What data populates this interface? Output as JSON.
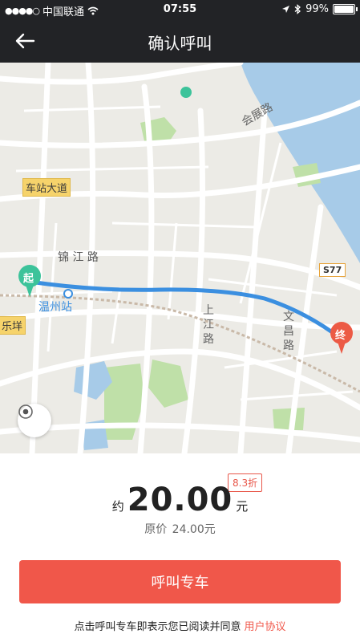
{
  "status": {
    "carrier": "中国联通",
    "time": "07:55",
    "battery": "99%",
    "battery_level": 0.99
  },
  "nav": {
    "title": "确认呼叫",
    "back_icon": "back-arrow-icon"
  },
  "map": {
    "labels": {
      "station_road": "车站大道",
      "jinjiang_road": "锦 江 路",
      "wenzhou_station": "温州站",
      "lexiang": "乐垟",
      "huizhan_road": "会展路",
      "shangjiang_road": "上江路",
      "wenchang_road": "文昌路",
      "s77": "S77"
    },
    "start_marker": "起",
    "end_marker": "终",
    "colors": {
      "route": "#3b8fe0",
      "start": "#3cc39a",
      "end": "#ec5a45",
      "water": "#a7cbe8",
      "park": "#bfe0a8"
    }
  },
  "fare": {
    "discount": "8.3折",
    "approx": "约",
    "price": "20.00",
    "unit": "元",
    "orig_label": "原价",
    "orig_price": "24.00元"
  },
  "actions": {
    "call_button": "呼叫专车",
    "agree_text": "点击呼叫专车即表示您已阅读并同意",
    "agree_link": "用户协议"
  }
}
